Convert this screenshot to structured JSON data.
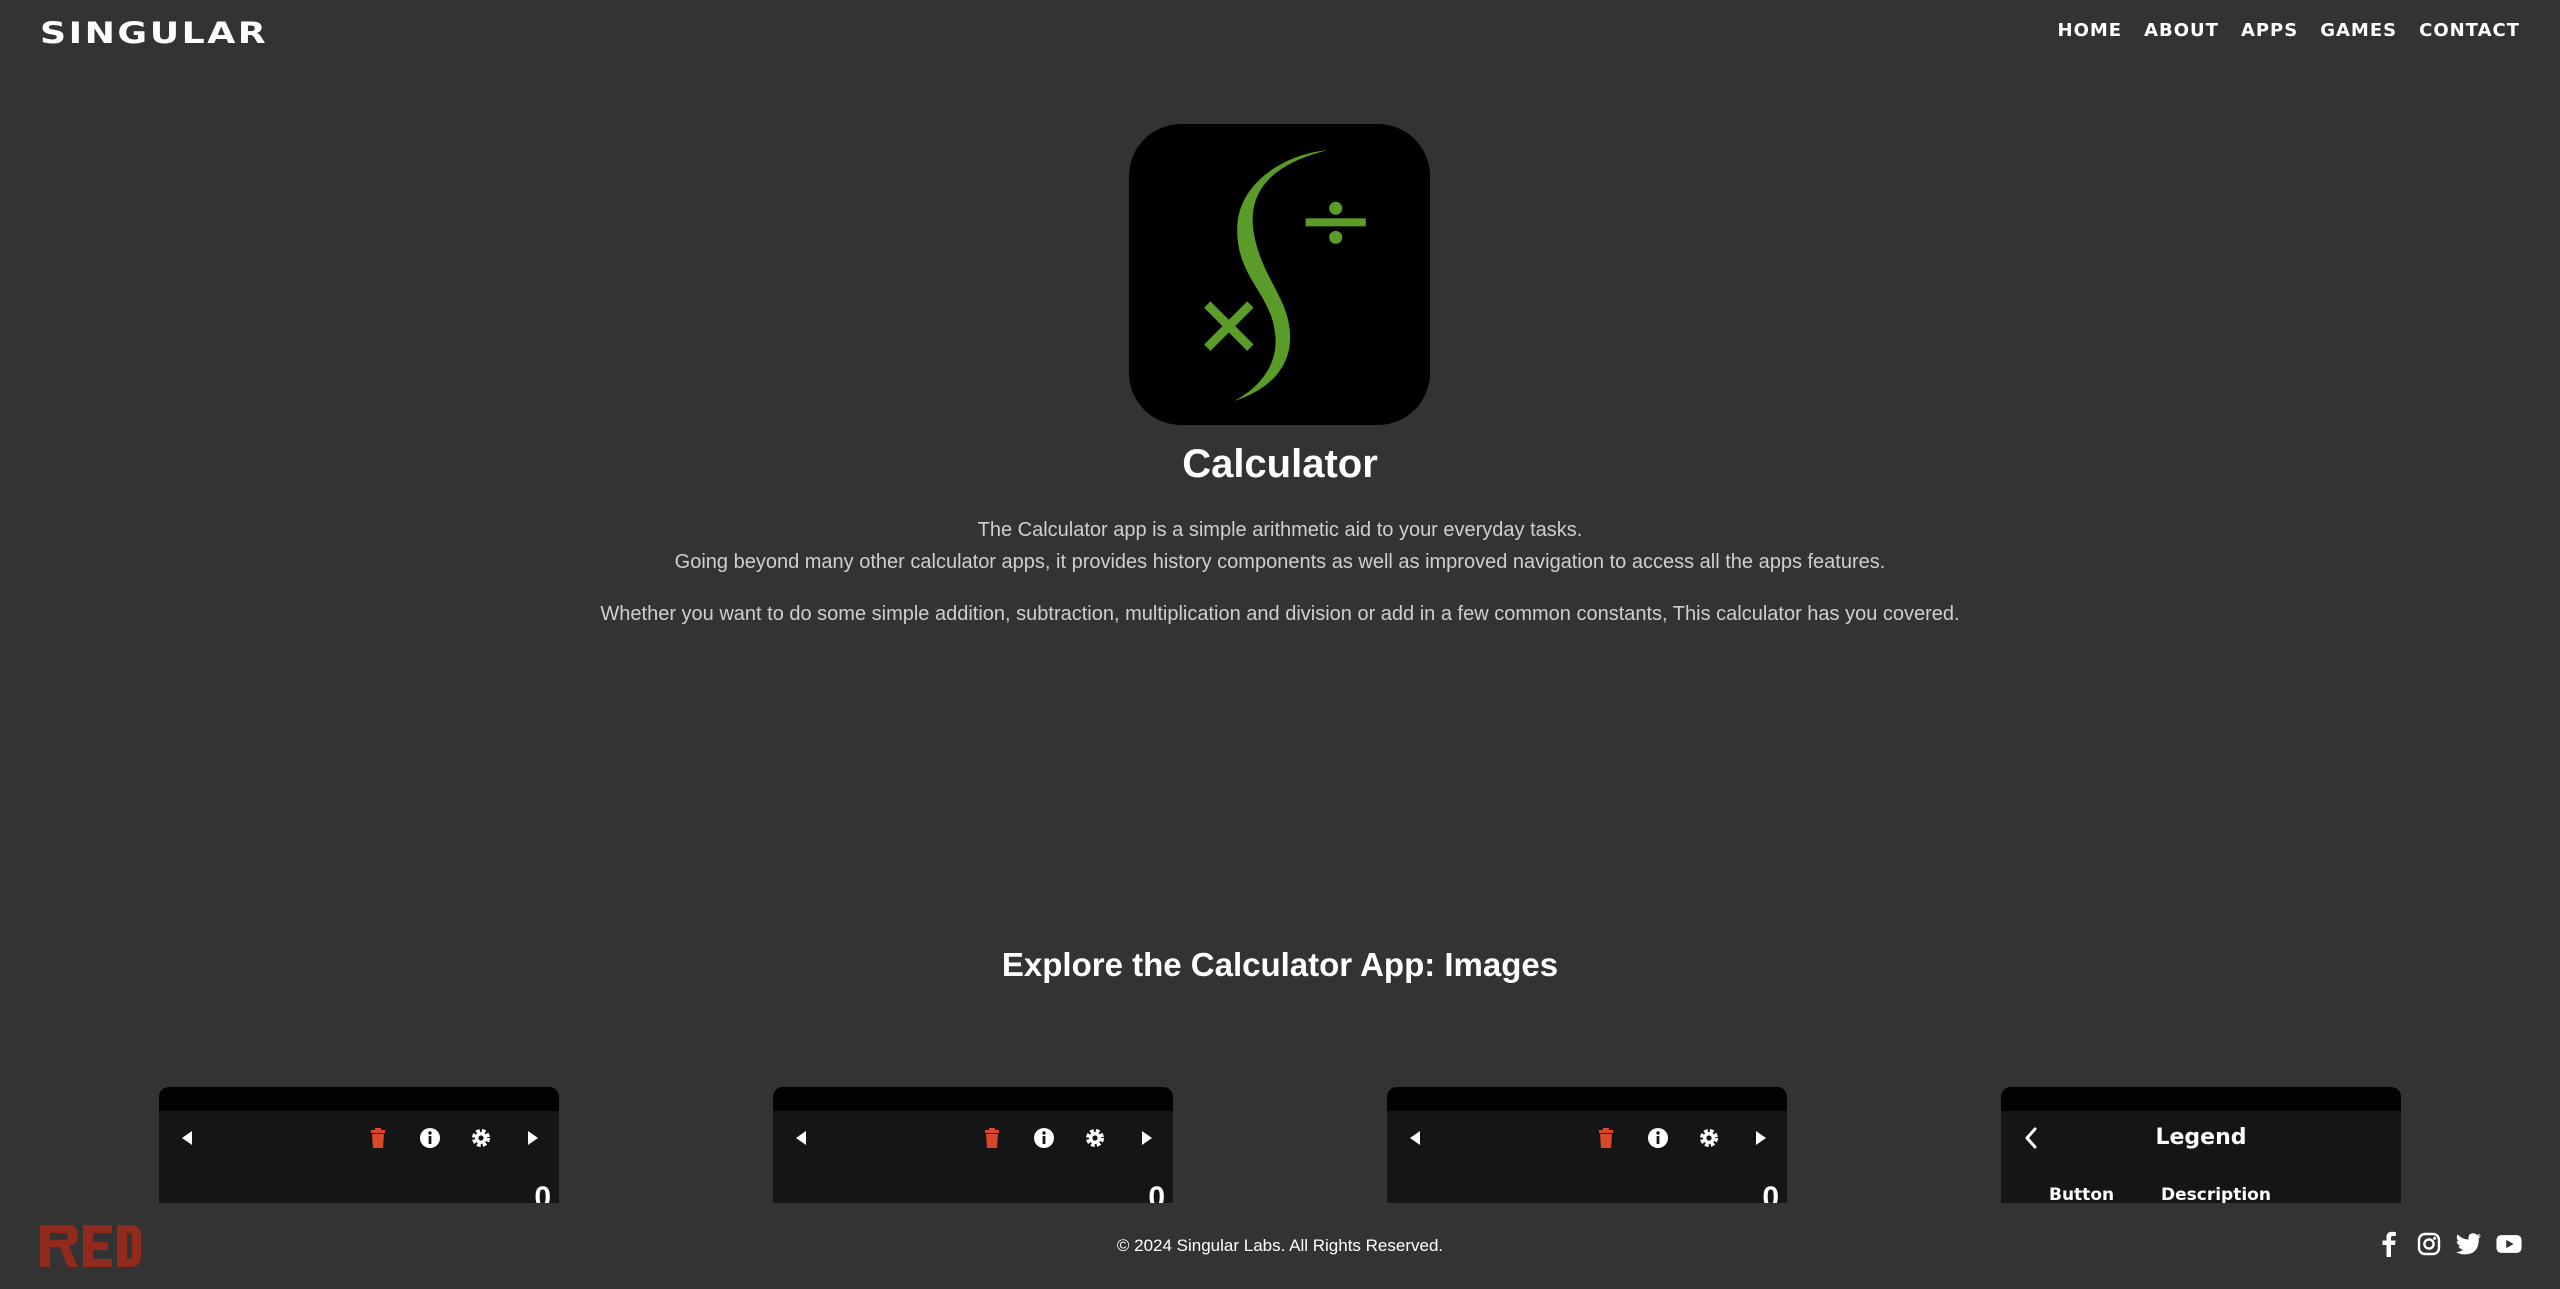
{
  "brand": {
    "name": "SINGULAR"
  },
  "nav": {
    "items": [
      {
        "label": "HOME"
      },
      {
        "label": "ABOUT"
      },
      {
        "label": "APPS"
      },
      {
        "label": "GAMES"
      },
      {
        "label": "CONTACT"
      }
    ]
  },
  "hero": {
    "title": "Calculator",
    "desc_line1": "The Calculator app is a simple arithmetic aid to your everyday tasks.",
    "desc_line2": "Going beyond many other calculator apps, it provides history components as well as improved navigation to access all the apps features.",
    "desc_line3": "Whether you want to do some simple addition, subtraction, multiplication and division or add in a few common constants, This calculator has you covered."
  },
  "gallery": {
    "title": "Explore the Calculator App: Images",
    "cards": [
      {
        "display_value": "0"
      },
      {
        "display_value": "0"
      },
      {
        "display_value": "0"
      },
      {
        "legend_title": "Legend",
        "col_button": "Button",
        "col_description": "Description"
      }
    ]
  },
  "footer": {
    "copyright": "© 2024 Singular Labs. All Rights Reserved.",
    "social": [
      "facebook-icon",
      "instagram-icon",
      "twitter-icon",
      "youtube-icon"
    ]
  },
  "colors": {
    "background": "#333333",
    "accent_green": "#5a9b2a",
    "trash_red": "#d9482b",
    "logo_red": "#8f2a1c"
  }
}
